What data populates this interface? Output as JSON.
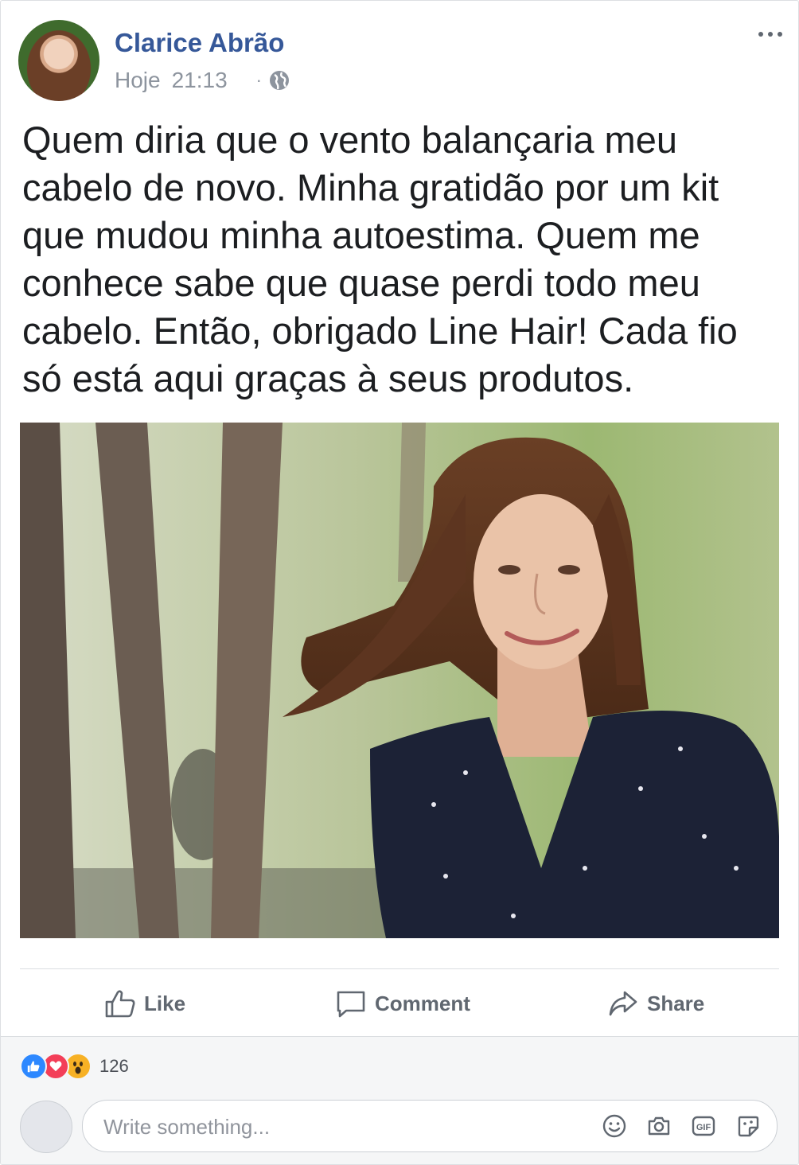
{
  "post": {
    "author": "Clarice Abrão",
    "date": "Hoje",
    "time": "21:13",
    "separator": "·",
    "text": "Quem diria que o vento balançaria meu cabelo de novo. Minha gratidão por um kit que mudou minha autoestima. Quem me conhece sabe que quase perdi todo meu cabelo. Então, obrigado Line Hair! Cada fio só está aqui graças à seus produtos."
  },
  "actions": {
    "like": "Like",
    "comment": "Comment",
    "share": "Share"
  },
  "reactions": {
    "types": [
      "like-icon",
      "love-icon",
      "wow-icon"
    ],
    "count": "126"
  },
  "comment_box": {
    "placeholder": "Write something..."
  },
  "colors": {
    "author_link": "#365899",
    "muted": "#606770",
    "like_blue": "#2d88ff",
    "love_red": "#f33e58",
    "wow_yellow": "#f7b125"
  }
}
